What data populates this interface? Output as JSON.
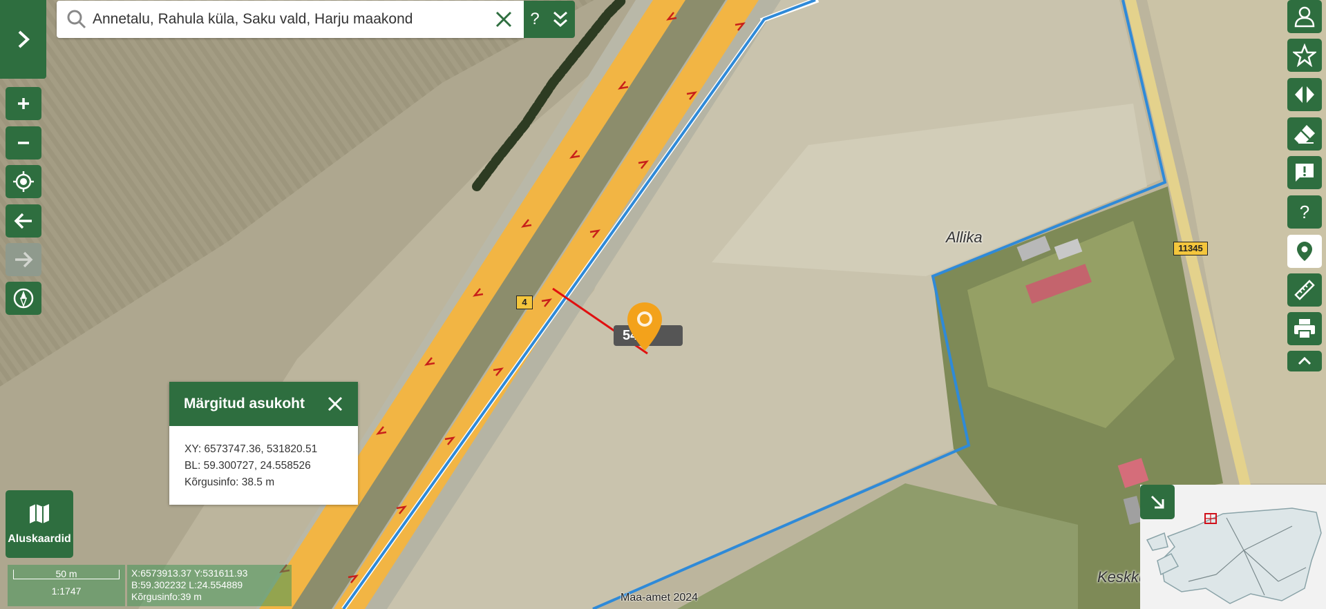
{
  "search": {
    "value": "Annetalu, Rahula küla, Saku vald, Harju maakond"
  },
  "controls": {
    "help_label": "?"
  },
  "popup": {
    "title": "Märgitud asukoht",
    "xy": "XY: 6573747.36, 531820.51",
    "bl": "BL: 59.300727, 24.558526",
    "elevation": "Kõrgusinfo: 38.5 m"
  },
  "basemaps": {
    "label": "Aluskaardid"
  },
  "scale": {
    "distance": "50 m",
    "ratio": "1:1747"
  },
  "cursor": {
    "xy": "X:6573913.37 Y:531611.93",
    "bl": "B:59.302232 L:24.554889",
    "elevation": "Kõrgusinfo:39 m"
  },
  "attribution": "Maa-amet 2024",
  "measurement": {
    "label": "54 m"
  },
  "labels": {
    "road_main": "4",
    "road_side": "11345",
    "place_allika": "Allika",
    "place_keskkula": "Keskküla"
  },
  "icons": {
    "sidebar_toggle": "chevron-right-icon",
    "zoom_in": "plus-icon",
    "zoom_out": "minus-icon",
    "locate": "crosshair-icon",
    "back": "arrow-left-icon",
    "forward": "arrow-right-icon",
    "compass": "compass-icon",
    "account": "user-icon",
    "favorites": "star-icon",
    "compare": "split-arrows-icon",
    "clear": "eraser-icon",
    "feedback": "feedback-icon",
    "help": "help-icon",
    "marker": "location-pin-icon",
    "measure": "ruler-icon",
    "print": "printer-icon",
    "collapse": "chevron-up-icon"
  },
  "colors": {
    "brand_green": "#2e6e3f",
    "parcel_boundary": "#2f8ad8",
    "highway": "#f2b544",
    "marker": "#f3a21b",
    "measure_line": "#e01010"
  }
}
